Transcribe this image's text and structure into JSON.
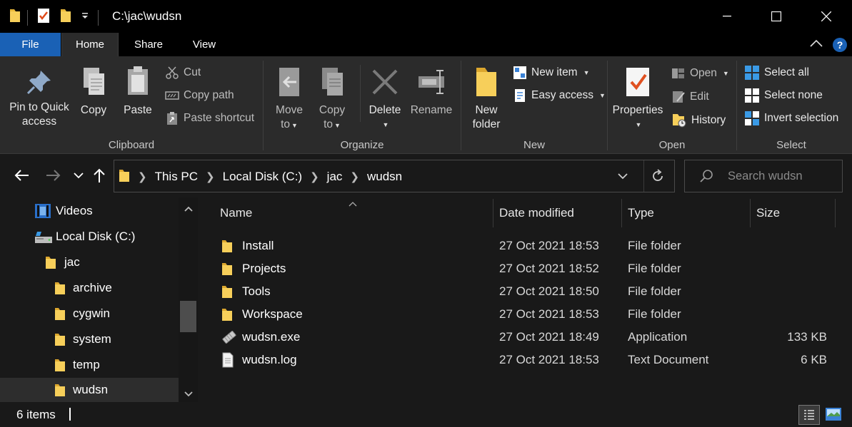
{
  "window": {
    "title": "C:\\jac\\wudsn",
    "controls": {
      "minimize": "minimize-icon",
      "maximize": "maximize-icon",
      "close": "close-icon"
    }
  },
  "tabs": [
    {
      "label": "File"
    },
    {
      "label": "Home"
    },
    {
      "label": "Share"
    },
    {
      "label": "View"
    }
  ],
  "ribbon": {
    "clipboard": {
      "label": "Clipboard",
      "pin_line1": "Pin to Quick",
      "pin_line2": "access",
      "copy": "Copy",
      "paste": "Paste",
      "cut": "Cut",
      "copy_path": "Copy path",
      "paste_shortcut": "Paste shortcut"
    },
    "organize": {
      "label": "Organize",
      "move_line1": "Move",
      "move_line2": "to",
      "copy_line1": "Copy",
      "copy_line2": "to",
      "delete": "Delete",
      "rename": "Rename"
    },
    "new": {
      "label": "New",
      "new_folder_line1": "New",
      "new_folder_line2": "folder",
      "new_item": "New item",
      "easy_access": "Easy access"
    },
    "open": {
      "label": "Open",
      "properties": "Properties",
      "open": "Open",
      "edit": "Edit",
      "history": "History"
    },
    "select": {
      "label": "Select",
      "select_all": "Select all",
      "select_none": "Select none",
      "invert_selection": "Invert selection"
    }
  },
  "address": {
    "crumbs": [
      "This PC",
      "Local Disk (C:)",
      "jac",
      "wudsn"
    ]
  },
  "search": {
    "placeholder": "Search wudsn"
  },
  "nav_tree": [
    {
      "label": "Videos",
      "icon": "videos-icon"
    },
    {
      "label": "Local Disk (C:)",
      "icon": "drive-icon"
    },
    {
      "label": "jac",
      "icon": "folder-icon"
    },
    {
      "label": "archive",
      "icon": "folder-icon"
    },
    {
      "label": "cygwin",
      "icon": "folder-icon"
    },
    {
      "label": "system",
      "icon": "folder-icon"
    },
    {
      "label": "temp",
      "icon": "folder-icon"
    },
    {
      "label": "wudsn",
      "icon": "folder-icon",
      "selected": true
    }
  ],
  "columns": {
    "name": "Name",
    "date": "Date modified",
    "type": "Type",
    "size": "Size"
  },
  "files": [
    {
      "name": "Install",
      "date": "27 Oct 2021 18:53",
      "type": "File folder",
      "size": "",
      "icon": "folder-icon"
    },
    {
      "name": "Projects",
      "date": "27 Oct 2021 18:52",
      "type": "File folder",
      "size": "",
      "icon": "folder-icon"
    },
    {
      "name": "Tools",
      "date": "27 Oct 2021 18:50",
      "type": "File folder",
      "size": "",
      "icon": "folder-icon"
    },
    {
      "name": "Workspace",
      "date": "27 Oct 2021 18:53",
      "type": "File folder",
      "size": "",
      "icon": "folder-icon"
    },
    {
      "name": "wudsn.exe",
      "date": "27 Oct 2021 18:49",
      "type": "Application",
      "size": "133 KB",
      "icon": "exe-icon"
    },
    {
      "name": "wudsn.log",
      "date": "27 Oct 2021 18:53",
      "type": "Text Document",
      "size": "6 KB",
      "icon": "text-file-icon"
    }
  ],
  "status": {
    "count": "6 items"
  },
  "colors": {
    "accent": "#1a61b5",
    "background": "#191919",
    "ribbon": "#2b2b2b",
    "folder": "#f5c84c"
  }
}
